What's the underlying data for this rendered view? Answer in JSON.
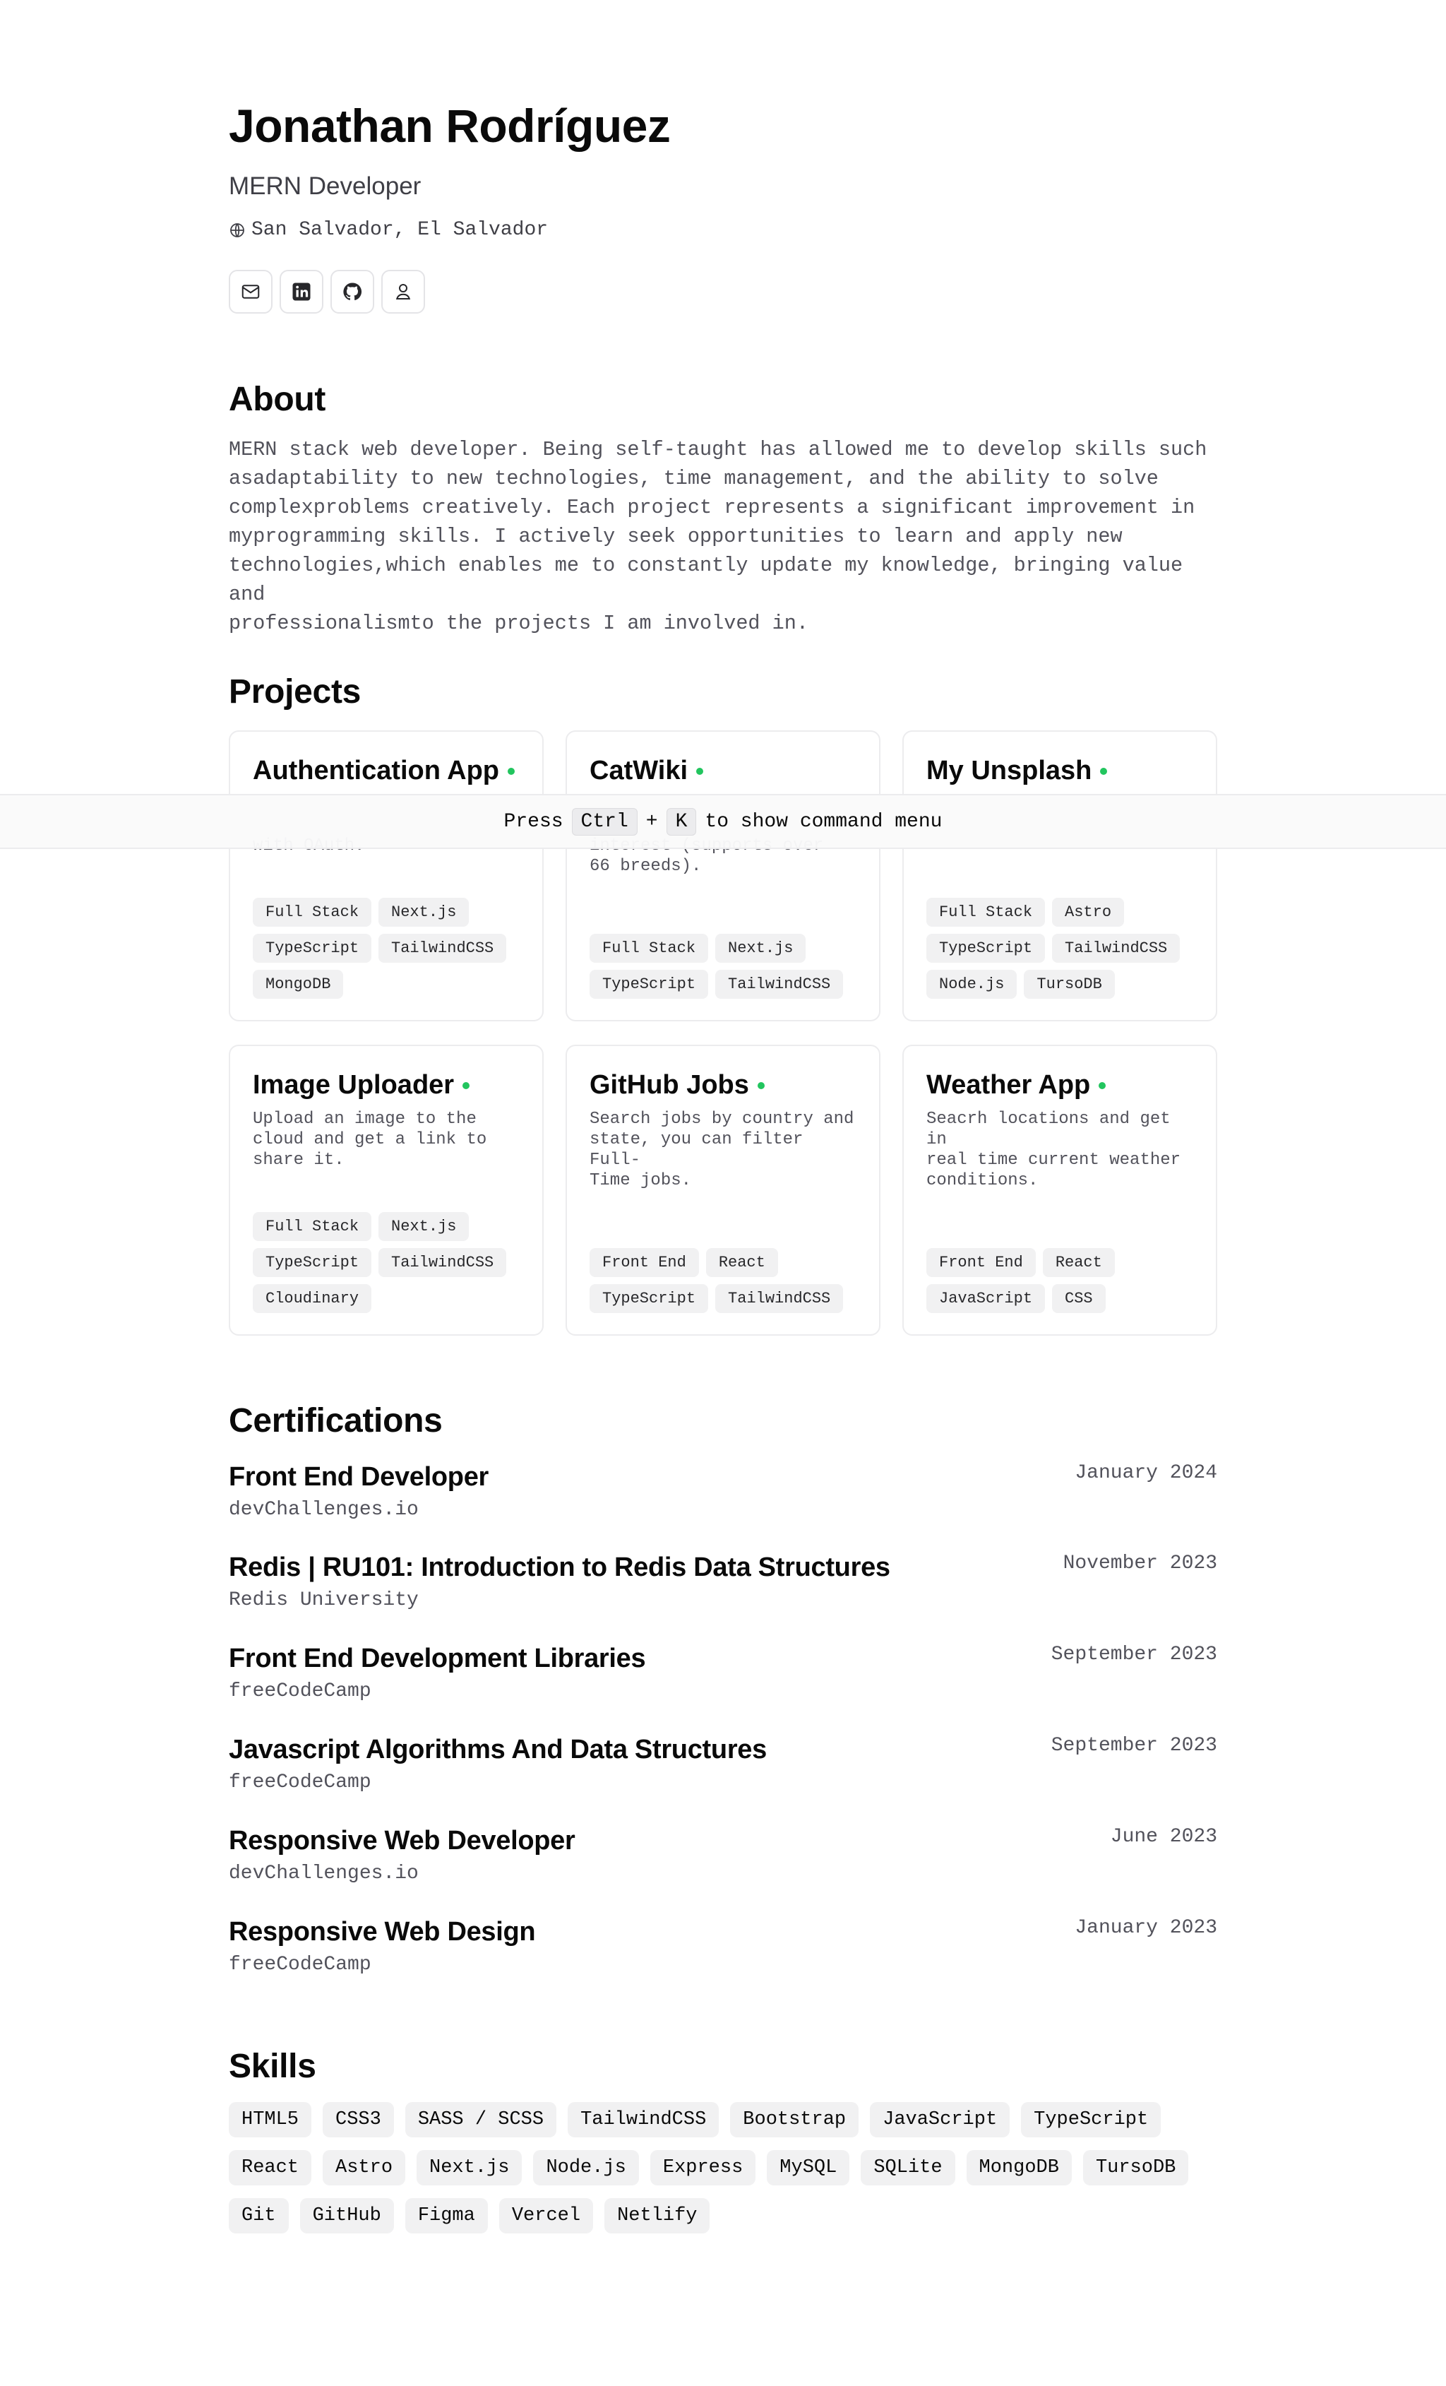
{
  "header": {
    "name": "Jonathan Rodríguez",
    "role": "MERN Developer",
    "location": "San Salvador, El Salvador",
    "socials": [
      {
        "icon": "mail-icon"
      },
      {
        "icon": "linkedin-icon"
      },
      {
        "icon": "github-icon"
      },
      {
        "icon": "user-icon"
      }
    ]
  },
  "about": {
    "heading": "About",
    "text": "MERN stack web developer. Being self-taught has allowed me to develop skills such\nasadaptability to new technologies, time management, and the ability to solve\ncomplexproblems creatively. Each project represents a significant improvement in\nmyprogramming skills. I actively seek opportunities to learn and apply new\ntechnologies,which enables me to constantly update my knowledge, bringing value and\nprofessionalismto the projects I am involved in."
  },
  "projects": {
    "heading": "Projects",
    "items": [
      {
        "title": "Authentication App",
        "description": "with OAuth.",
        "tags": [
          "Full Stack",
          "Next.js",
          "TypeScript",
          "TailwindCSS",
          "MongoDB"
        ]
      },
      {
        "title": "CatWiki",
        "description": "interest (supports over\n66 breeds).",
        "tags": [
          "Full Stack",
          "Next.js",
          "TypeScript",
          "TailwindCSS"
        ]
      },
      {
        "title": "My Unsplash",
        "description": "",
        "tags": [
          "Full Stack",
          "Astro",
          "TypeScript",
          "TailwindCSS",
          "Node.js",
          "TursoDB"
        ]
      },
      {
        "title": "Image Uploader",
        "description": "Upload an image to the\ncloud and get a link to\nshare it.",
        "tags": [
          "Full Stack",
          "Next.js",
          "TypeScript",
          "TailwindCSS",
          "Cloudinary"
        ]
      },
      {
        "title": "GitHub Jobs",
        "description": "Search jobs by country and\nstate, you can filter Full-\nTime jobs.",
        "tags": [
          "Front End",
          "React",
          "TypeScript",
          "TailwindCSS"
        ]
      },
      {
        "title": "Weather App",
        "description": "Seacrh locations and get in\nreal time current weather\nconditions.",
        "tags": [
          "Front End",
          "React",
          "JavaScript",
          "CSS"
        ]
      }
    ]
  },
  "command_bar": {
    "prefix": "Press",
    "key1": "Ctrl",
    "plus": "+",
    "key2": "K",
    "suffix": "to show command menu"
  },
  "certifications": {
    "heading": "Certifications",
    "items": [
      {
        "title": "Front End Developer",
        "issuer": "devChallenges.io",
        "date": "January 2024"
      },
      {
        "title": "Redis | RU101: Introduction to Redis Data Structures",
        "issuer": "Redis University",
        "date": "November 2023"
      },
      {
        "title": "Front End Development Libraries",
        "issuer": "freeCodeCamp",
        "date": "September 2023"
      },
      {
        "title": "Javascript Algorithms And Data Structures",
        "issuer": "freeCodeCamp",
        "date": "September 2023"
      },
      {
        "title": "Responsive Web Developer",
        "issuer": "devChallenges.io",
        "date": "June 2023"
      },
      {
        "title": "Responsive Web Design",
        "issuer": "freeCodeCamp",
        "date": "January 2023"
      }
    ]
  },
  "skills": {
    "heading": "Skills",
    "items": [
      "HTML5",
      "CSS3",
      "SASS / SCSS",
      "TailwindCSS",
      "Bootstrap",
      "JavaScript",
      "TypeScript",
      "React",
      "Astro",
      "Next.js",
      "Node.js",
      "Express",
      "MySQL",
      "SQLite",
      "MongoDB",
      "TursoDB",
      "Git",
      "GitHub",
      "Figma",
      "Vercel",
      "Netlify"
    ]
  },
  "colors": {
    "accent_dot": "#22c55e",
    "text_muted": "#52525b",
    "tag_bg": "#f1f1f2"
  }
}
